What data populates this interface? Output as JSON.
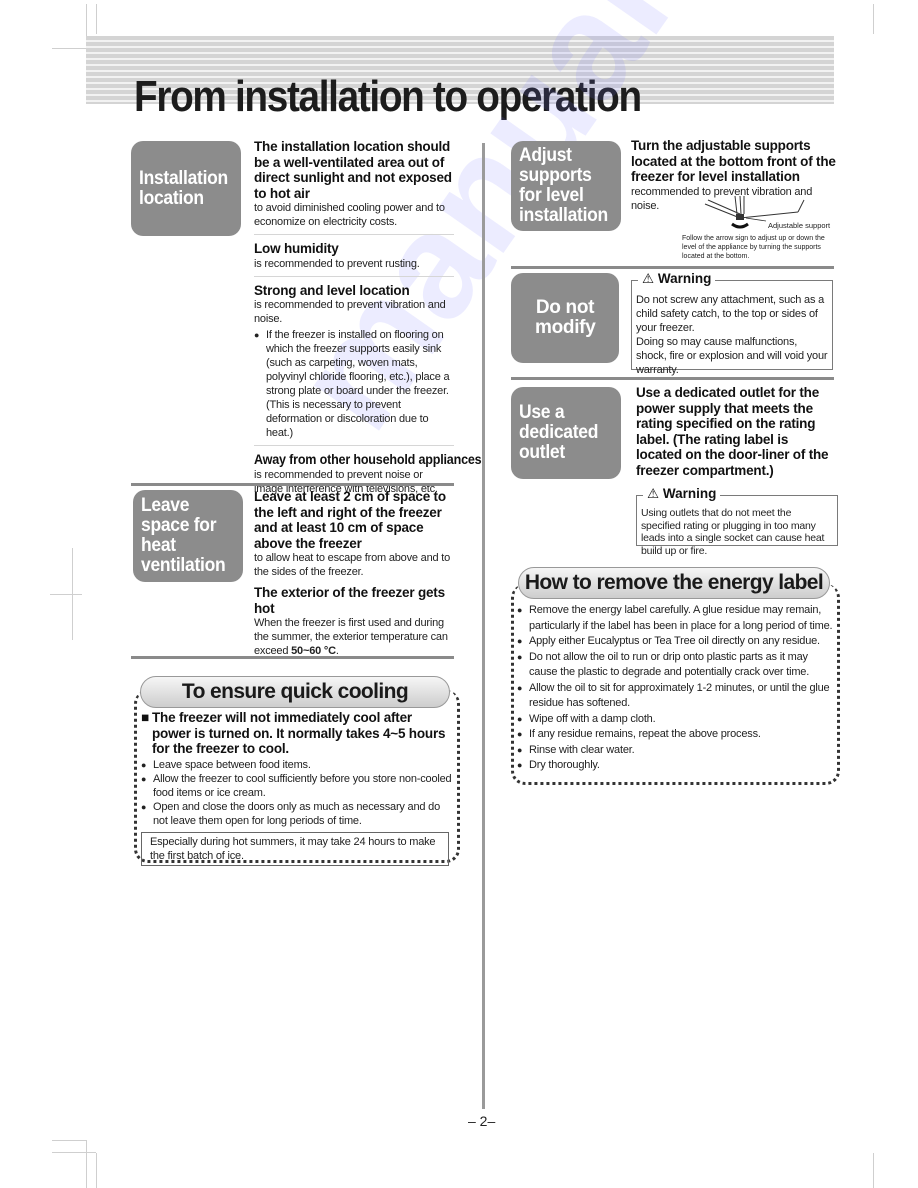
{
  "page": {
    "title": "From installation to operation",
    "page_number": "– 2–",
    "watermark": "manualsarchive.com"
  },
  "left": {
    "installation": {
      "label": "Installation location",
      "items": [
        {
          "heading": "The installation location should be a well-ventilated area out of direct sunlight and not exposed to hot air",
          "text": "to avoid diminished cooling power and to economize on electricity costs."
        },
        {
          "heading": "Low humidity",
          "text": "is recommended to prevent rusting."
        },
        {
          "heading": "Strong and level location",
          "text": "is recommended to prevent vibration and noise.",
          "bullet": "If the freezer is installed on flooring on which the freezer supports easily sink (such as carpeting, woven mats, polyvinyl chloride flooring, etc.), place a strong plate or board under the freezer. (This is necessary to prevent deformation or discoloration due to heat.)"
        },
        {
          "heading": "Away from other household appliances",
          "text": "is recommended to prevent noise or image interference with televisions, etc."
        }
      ]
    },
    "ventilation": {
      "label": "Leave space for heat ventilation",
      "items": [
        {
          "heading": "Leave at least 2 cm of space to the left and right of the freezer and at least 10 cm of space above the freezer",
          "text": "to allow heat to escape from above and to the sides of the freezer."
        },
        {
          "heading": "The exterior of the freezer gets hot",
          "text": "When the freezer is first used and during the summer, the exterior temperature can exceed ",
          "emphasis": "50~60 °C",
          "suffix": "."
        }
      ]
    },
    "cooling": {
      "title": "To ensure quick cooling",
      "lead": "The freezer will not immediately cool after power is turned on. It normally takes 4~5 hours for the freezer to cool.",
      "bullets": [
        "Leave space between food items.",
        "Allow the freezer to cool sufficiently before you store non-cooled food items or ice cream.",
        "Open and close the doors only as much as necessary and do not leave them open for long periods of time."
      ],
      "note": "Especially during hot summers, it may take 24 hours to make the first batch of ice."
    }
  },
  "right": {
    "adjust": {
      "label": "Adjust supports for level installation",
      "heading": "Turn the adjustable supports located at the bottom front of the freezer for level installation",
      "text": "recommended to prevent vibration and noise.",
      "diagram_label": "Adjustable support",
      "diagram_caption": "Follow the arrow sign to adjust up or down the level of the appliance by turning the supports located at the bottom."
    },
    "modify": {
      "label": "Do not modify",
      "warning_title": "Warning",
      "warning_text": "Do not screw any attachment, such as a child safety catch, to the top or sides of your freezer.",
      "warning_text2": "Doing so may cause malfunctions, shock, fire or explosion and will void your warranty."
    },
    "outlet": {
      "label": "Use a dedicated outlet",
      "heading": "Use a dedicated outlet for the power supply that meets the rating specified on the rating label. (The rating label is located on the door-liner of the freezer compartment.)",
      "warning_title": "Warning",
      "warning_text": "Using outlets that do not meet the specified rating or plugging in too many leads into a single socket can cause heat build up or fire."
    },
    "energy": {
      "title": "How to remove the energy label",
      "bullets": [
        "Remove the energy label carefully. A glue residue may remain, particularly if the label has been in place for a long period of time.",
        "Apply either Eucalyptus or Tea Tree oil directly on any residue.",
        "Do not allow the oil to run or drip onto plastic parts as it may cause the plastic to degrade and potentially crack over time.",
        "Allow the oil to sit for approximately 1-2 minutes, or until the glue residue has softened.",
        "Wipe off with a damp cloth.",
        "If any residue remains, repeat the above process.",
        "Rinse with clear water.",
        "Dry thoroughly."
      ]
    }
  },
  "colors": {
    "label_box": "#8c8c8c",
    "divider": "#8a8a8a",
    "stripe": "#d4d4d4"
  }
}
